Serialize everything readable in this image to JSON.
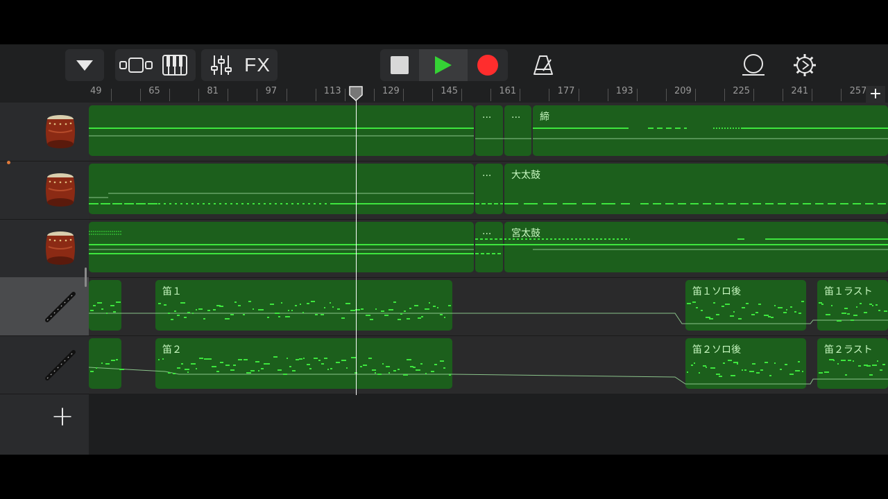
{
  "toolbar": {
    "fx_label": "FX"
  },
  "ruler": {
    "bars": [
      "49",
      "65",
      "81",
      "97",
      "113",
      "129",
      "145",
      "161",
      "177",
      "193",
      "209",
      "225",
      "241",
      "257"
    ],
    "add_symbol": "+"
  },
  "tracks": [
    {
      "instrument": "taiko-drum",
      "regions": [
        {
          "name": ""
        },
        {
          "name": "..."
        },
        {
          "name": "..."
        },
        {
          "name": "締"
        }
      ]
    },
    {
      "instrument": "taiko-drum",
      "regions": [
        {
          "name": ""
        },
        {
          "name": "..."
        },
        {
          "name": "大太鼓"
        }
      ]
    },
    {
      "instrument": "taiko-drum",
      "regions": [
        {
          "name": ""
        },
        {
          "name": "..."
        },
        {
          "name": "宮太鼓"
        }
      ]
    },
    {
      "instrument": "shinobue-flute",
      "regions": [
        {
          "name": ""
        },
        {
          "name": "笛１"
        },
        {
          "name": "笛１ソロ後"
        },
        {
          "name": "笛１ラスト"
        }
      ]
    },
    {
      "instrument": "shinobue-flute",
      "regions": [
        {
          "name": ""
        },
        {
          "name": "笛２"
        },
        {
          "name": "笛２ソロ後"
        },
        {
          "name": "笛２ラスト"
        }
      ]
    }
  ],
  "add_track_symbol": "+",
  "colors": {
    "region": "#1c5f1c",
    "note": "#3ee63e",
    "record": "#ff2d2d",
    "play": "#35d235"
  }
}
